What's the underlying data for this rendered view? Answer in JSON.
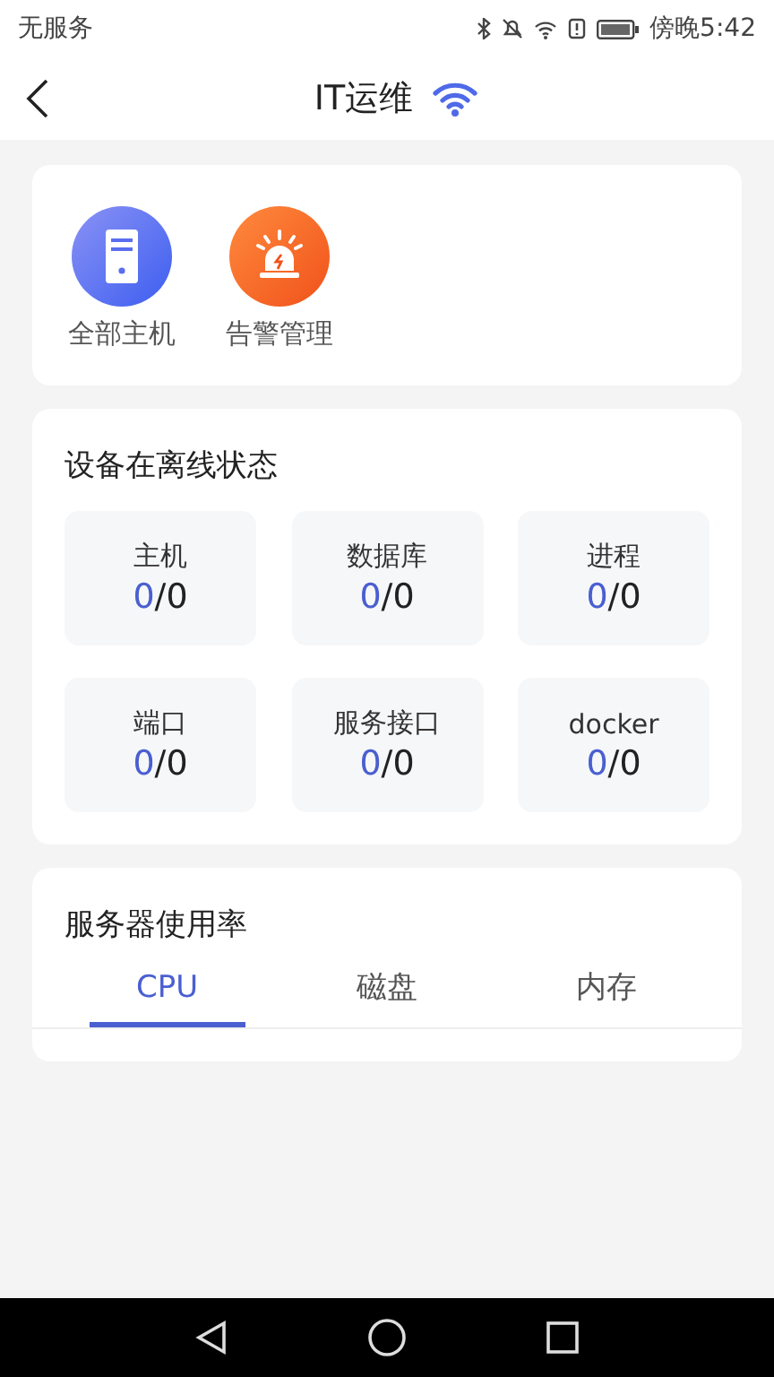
{
  "status_bar": {
    "carrier": "无服务",
    "time": "傍晚5:42"
  },
  "header": {
    "title": "IT运维"
  },
  "shortcuts": [
    {
      "kind": "server",
      "label": "全部主机"
    },
    {
      "kind": "alarm",
      "label": "告警管理"
    }
  ],
  "device_status": {
    "title": "设备在离线状态",
    "items": [
      {
        "label": "主机",
        "online": "0",
        "rest": "/0"
      },
      {
        "label": "数据库",
        "online": "0",
        "rest": "/0"
      },
      {
        "label": "进程",
        "online": "0",
        "rest": "/0"
      },
      {
        "label": "端口",
        "online": "0",
        "rest": "/0"
      },
      {
        "label": "服务接口",
        "online": "0",
        "rest": "/0"
      },
      {
        "label": "docker",
        "online": "0",
        "rest": "/0"
      }
    ]
  },
  "usage": {
    "title": "服务器使用率",
    "tabs": [
      {
        "label": "CPU",
        "selected": true
      },
      {
        "label": "磁盘",
        "selected": false
      },
      {
        "label": "内存",
        "selected": false
      }
    ]
  }
}
